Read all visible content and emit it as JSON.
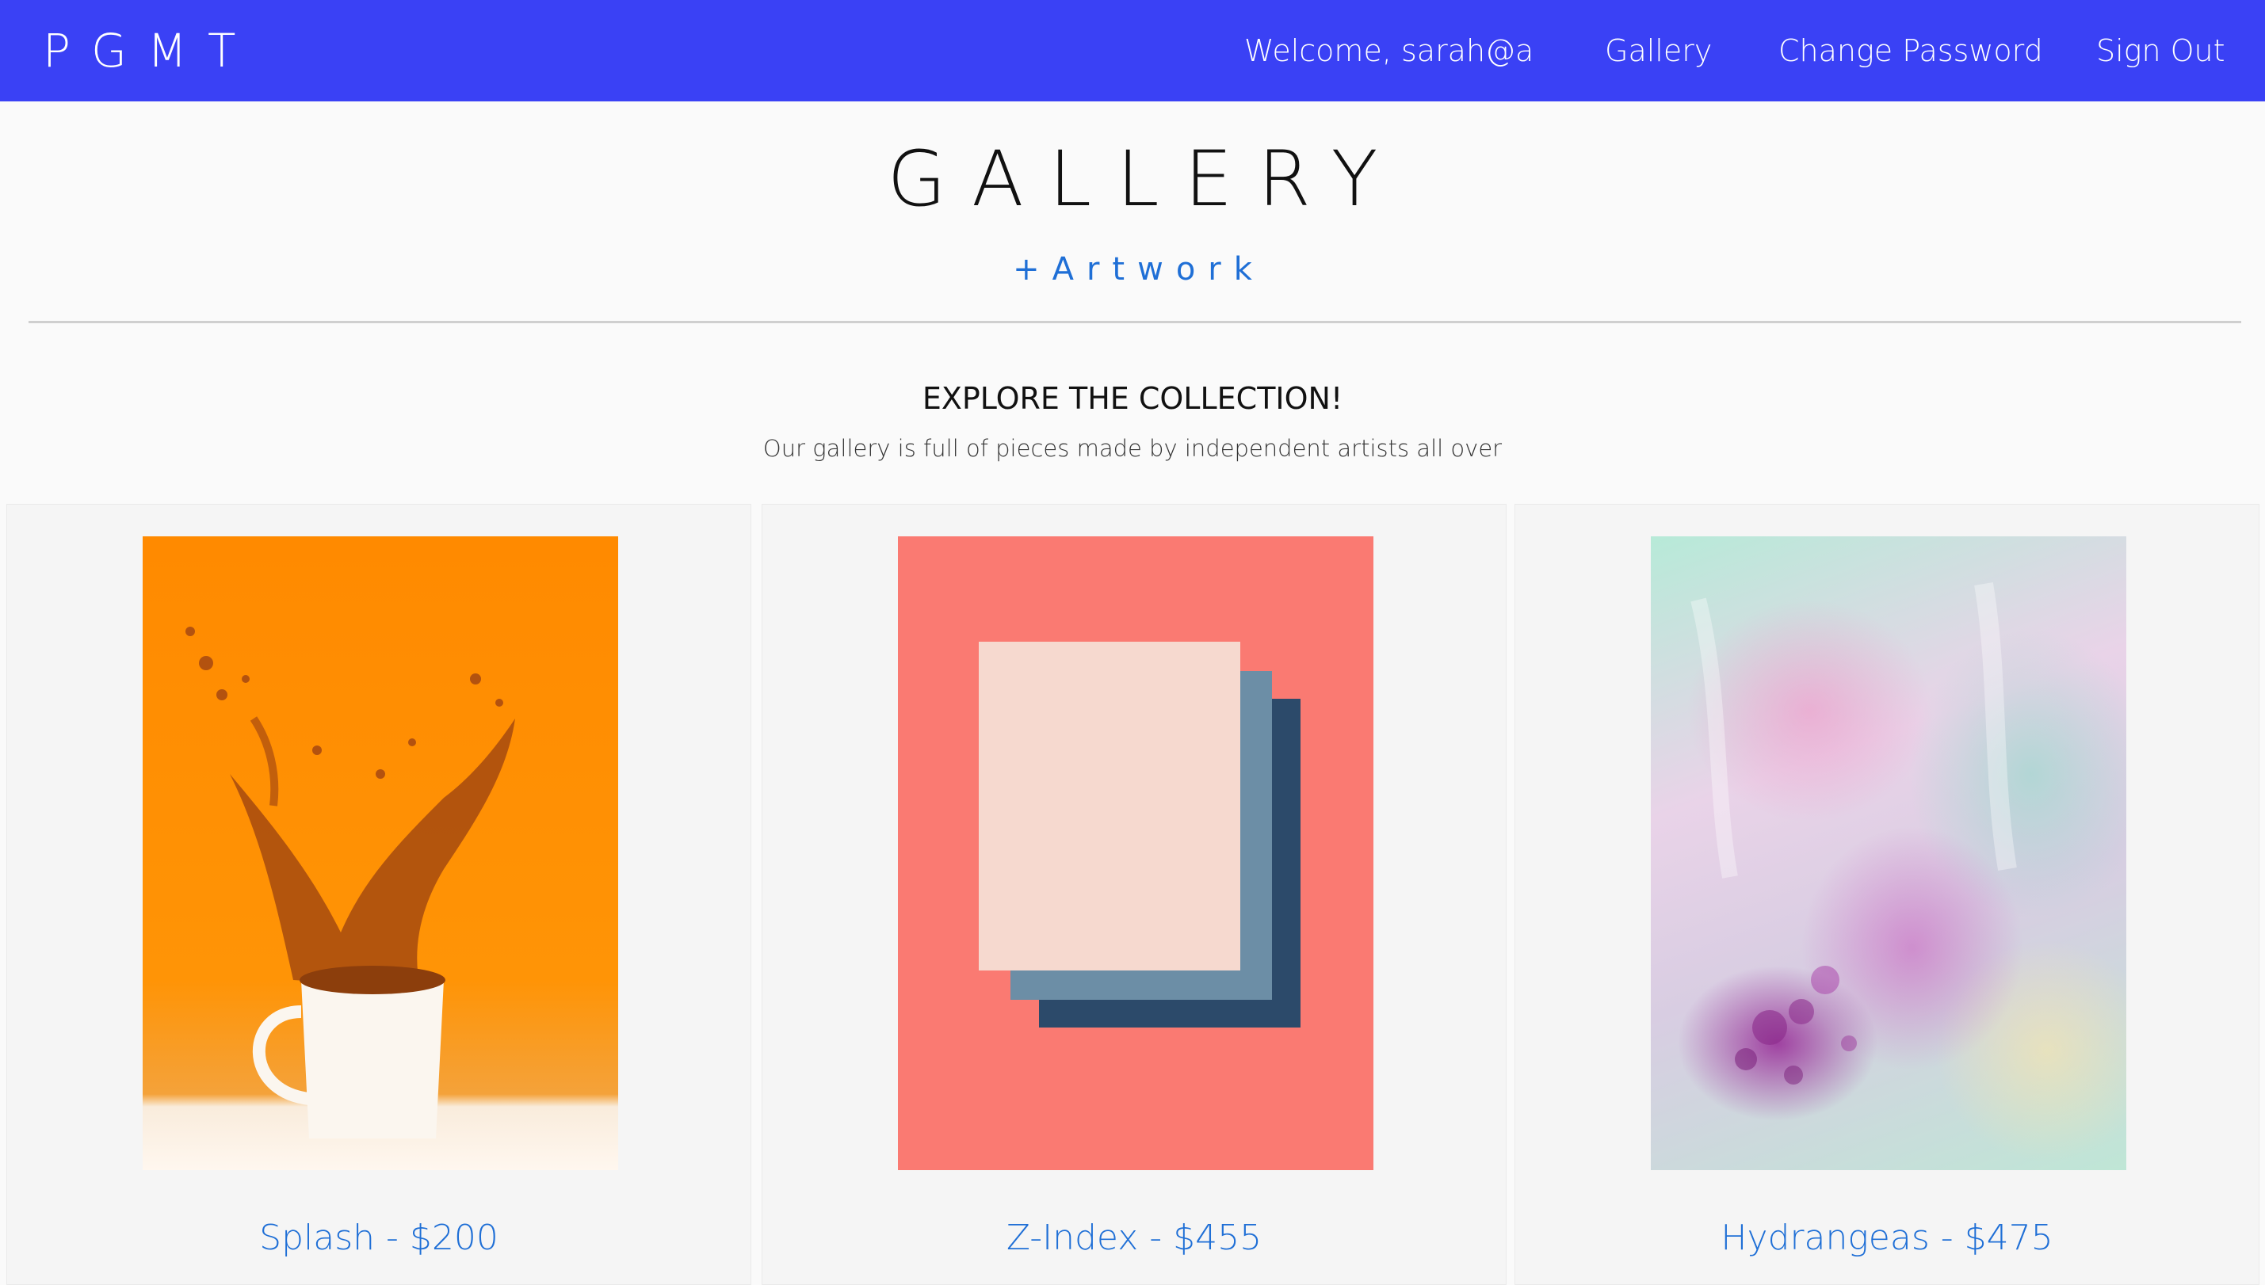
{
  "nav": {
    "brand": "PGMT",
    "welcome": "Welcome, sarah@a",
    "links": [
      {
        "label": "Gallery"
      },
      {
        "label": "Change Password"
      },
      {
        "label": "Sign Out"
      }
    ]
  },
  "header": {
    "title": "GALLERY",
    "add_link": "+Artwork"
  },
  "collection": {
    "heading": "EXPLORE THE COLLECTION!",
    "subheading": "Our gallery is full of pieces made by independent artists all over"
  },
  "artworks": [
    {
      "caption": "Splash - $200",
      "image": "orange-splash-mug"
    },
    {
      "caption": "Z-Index - $455",
      "image": "stacked-papers-on-coral"
    },
    {
      "caption": "Hydrangeas - $475",
      "image": "pastel-abstract-painting"
    }
  ],
  "colors": {
    "navbar": "#3a41f5",
    "link": "#1f6fd6",
    "background": "#fafafa"
  }
}
